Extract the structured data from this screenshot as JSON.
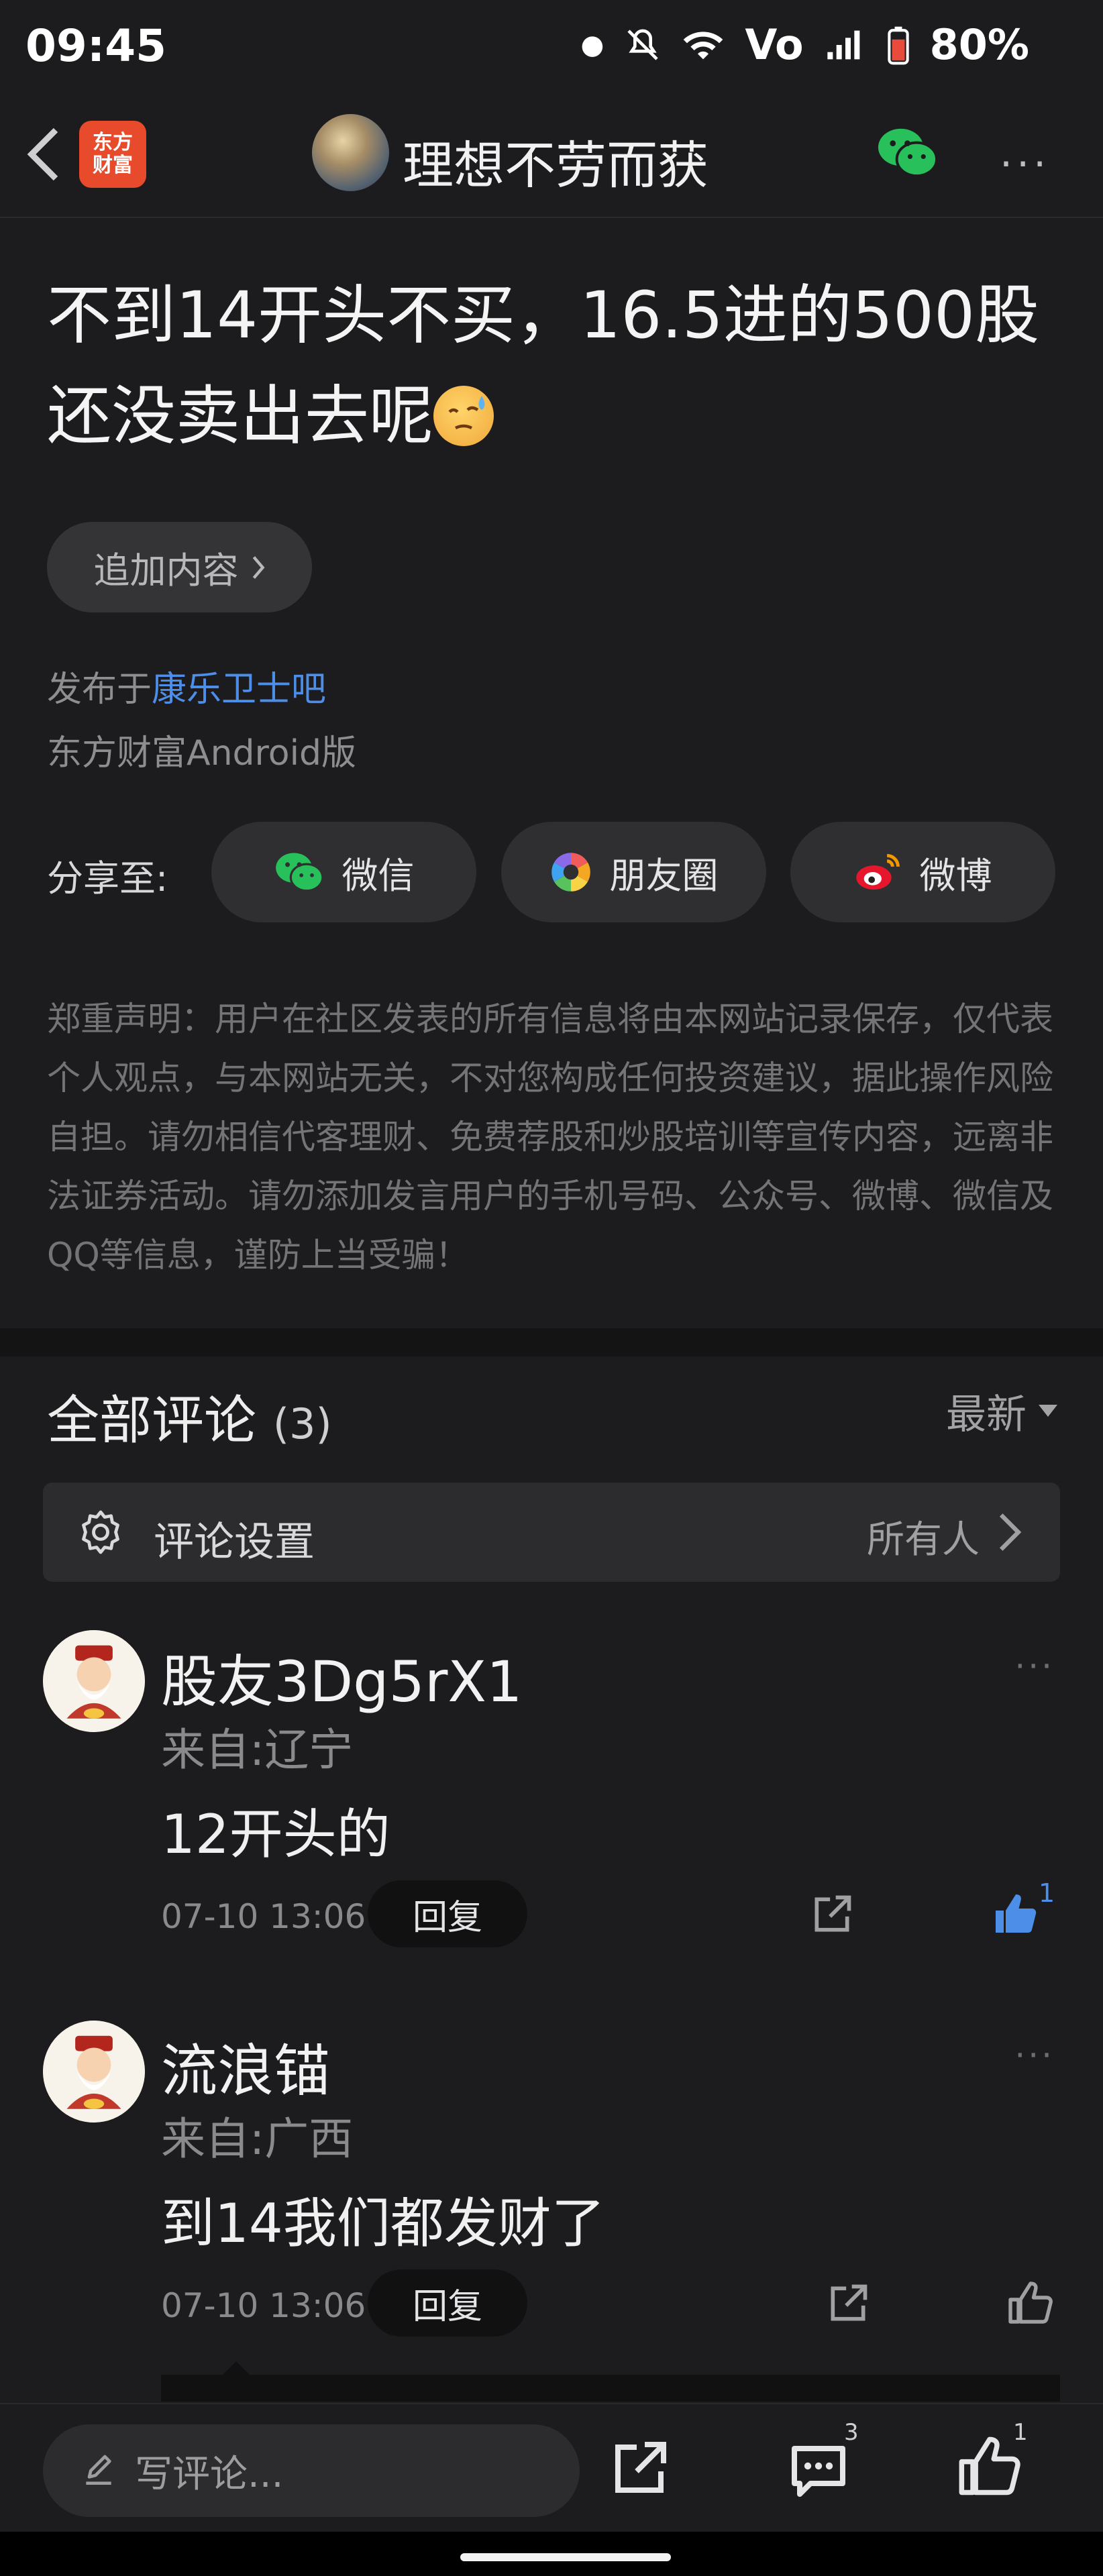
{
  "status_bar": {
    "time": "09:45",
    "battery": "80%",
    "icons": [
      "dot-icon",
      "mute-icon",
      "wifi-icon",
      "volte-icon",
      "signal-icon",
      "battery-icon"
    ]
  },
  "nav": {
    "app_logo_line1": "东方",
    "app_logo_line2": "财富",
    "title": "理想不劳而获",
    "more": "···"
  },
  "post": {
    "title": "不到14开头不买，16.5进的500股还没卖出去呢",
    "add_content": "追加内容",
    "published_prefix": "发布于",
    "forum": "康乐卫士吧",
    "client": "东方财富Android版"
  },
  "share": {
    "label": "分享至:",
    "wechat": "微信",
    "moments": "朋友圈",
    "weibo": "微博"
  },
  "disclaimer": "郑重声明：用户在社区发表的所有信息将由本网站记录保存，仅代表个人观点，与本网站无关，不对您构成任何投资建议，据此操作风险自担。请勿相信代客理财、免费荐股和炒股培训等宣传内容，远离非法证券活动。请勿添加发言用户的手机号码、公众号、微博、微信及QQ等信息，谨防上当受骗！",
  "comments": {
    "title": "全部评论",
    "count": "(3)",
    "sort": "最新",
    "settings_label": "评论设置",
    "settings_value": "所有人",
    "items": [
      {
        "name": "股友3Dg5rX1",
        "location": "来自:辽宁",
        "text": "12开头的",
        "time": "07-10 13:06",
        "reply": "回复",
        "likes": "1"
      },
      {
        "name": "流浪锚",
        "location": "来自:广西",
        "text": "到14我们都发财了",
        "time": "07-10 13:06",
        "reply": "回复",
        "likes": ""
      }
    ]
  },
  "bottom_bar": {
    "placeholder": "写评论...",
    "comment_count": "3",
    "like_count": "1"
  },
  "colors": {
    "background": "#1c1c1e",
    "link": "#4d8ee8",
    "app_logo": "#e84a2c"
  }
}
